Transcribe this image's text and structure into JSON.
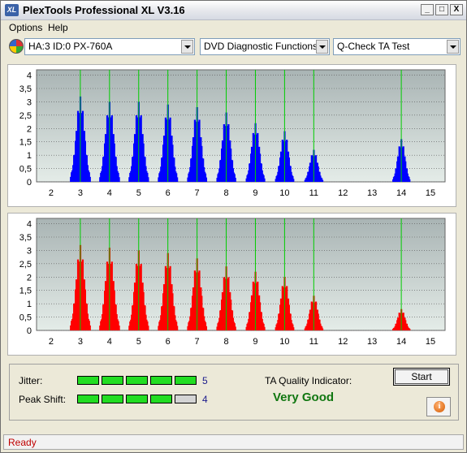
{
  "window": {
    "title": "PlexTools Professional XL V3.16",
    "app_icon_text": "XL",
    "controls": [
      "_",
      "□",
      "X"
    ]
  },
  "menu": [
    {
      "label": "Options",
      "underline": "O"
    },
    {
      "label": "Help",
      "underline": "H"
    }
  ],
  "toolbar": {
    "drive": "HA:3 ID:0  PX-760A",
    "function": "DVD Diagnostic Functions",
    "test": "Q-Check TA Test"
  },
  "charts": {
    "x_ticks": [
      "2",
      "3",
      "4",
      "5",
      "6",
      "7",
      "8",
      "9",
      "10",
      "11",
      "12",
      "13",
      "14",
      "15"
    ],
    "y_ticks": [
      "4",
      "3,5",
      "3",
      "2,5",
      "2",
      "1,5",
      "1",
      "0,5",
      "0"
    ],
    "xlim": [
      1.5,
      15.5
    ],
    "ylim": [
      0,
      4.2
    ],
    "marker_lines": [
      3,
      4,
      5,
      6,
      7,
      8,
      9,
      10,
      11,
      14
    ],
    "colors": {
      "top": "#0000ff",
      "bottom": "#ff0000",
      "marker": "#00cc00"
    }
  },
  "chart_data": [
    {
      "type": "bar",
      "name": "top",
      "peaks": [
        {
          "x": 3,
          "height": 3.2
        },
        {
          "x": 4,
          "height": 3.0
        },
        {
          "x": 5,
          "height": 3.0
        },
        {
          "x": 6,
          "height": 2.9
        },
        {
          "x": 7,
          "height": 2.8
        },
        {
          "x": 8,
          "height": 2.6
        },
        {
          "x": 9,
          "height": 2.2
        },
        {
          "x": 10,
          "height": 1.9
        },
        {
          "x": 11,
          "height": 1.2
        },
        {
          "x": 14,
          "height": 1.6
        }
      ]
    },
    {
      "type": "bar",
      "name": "bottom",
      "peaks": [
        {
          "x": 3,
          "height": 3.2
        },
        {
          "x": 4,
          "height": 3.1
        },
        {
          "x": 5,
          "height": 3.0
        },
        {
          "x": 6,
          "height": 2.9
        },
        {
          "x": 7,
          "height": 2.7
        },
        {
          "x": 8,
          "height": 2.4
        },
        {
          "x": 9,
          "height": 2.2
        },
        {
          "x": 10,
          "height": 2.0
        },
        {
          "x": 11,
          "height": 1.3
        },
        {
          "x": 14,
          "height": 0.8
        }
      ]
    }
  ],
  "results": {
    "jitter_label": "Jitter:",
    "jitter_value": "5",
    "jitter_level": 5,
    "peak_shift_label": "Peak Shift:",
    "peak_shift_value": "4",
    "peak_shift_level": 4,
    "max_level": 5,
    "quality_label": "TA Quality Indicator:",
    "quality_value": "Very Good",
    "start_label": "Start"
  },
  "status": {
    "text": "Ready"
  }
}
